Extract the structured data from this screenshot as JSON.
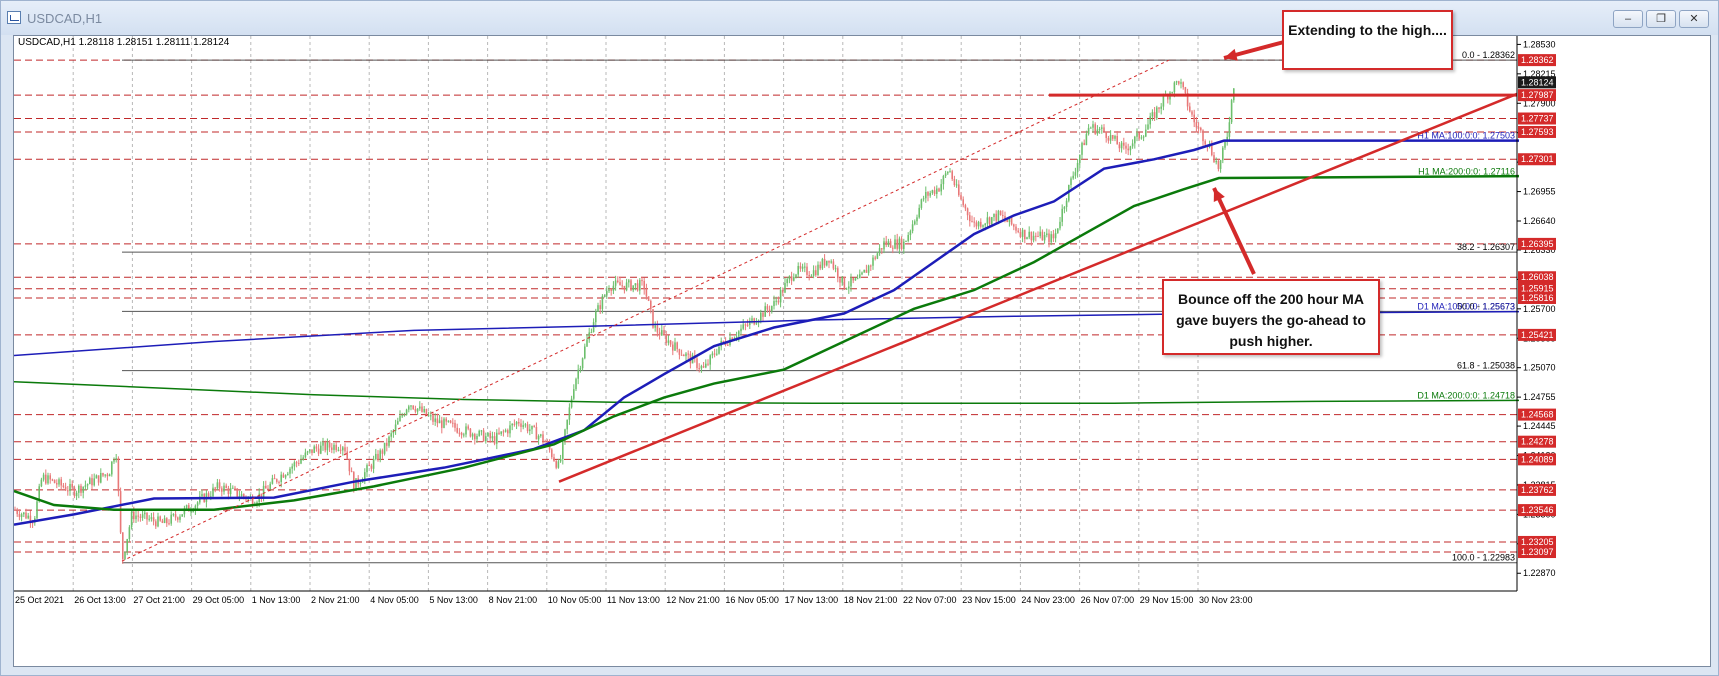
{
  "window": {
    "title": "USDCAD,H1",
    "minimize_icon": "minimize-icon",
    "restore_icon": "restore-icon",
    "close_icon": "close-icon"
  },
  "chart_data": {
    "type": "candlestick",
    "symbol_header": "USDCAD,H1",
    "ohlc_header": "1.28118 1.28151 1.28111 1.28124",
    "timeframe": "H1",
    "ylim": [
      1.2268,
      1.2862
    ],
    "y_ticks": [
      "1.28530",
      "1.28215",
      "1.27900",
      "1.27585",
      "1.27270",
      "1.26955",
      "1.26640",
      "1.26330",
      "1.26015",
      "1.25700",
      "1.25385",
      "1.25070",
      "1.24755",
      "1.24445",
      "1.24130",
      "1.23815",
      "1.23500",
      "1.23185",
      "1.22870"
    ],
    "x_ticks": [
      "25 Oct 2021",
      "26 Oct 13:00",
      "27 Oct 21:00",
      "29 Oct 05:00",
      "1 Nov 13:00",
      "2 Nov 21:00",
      "4 Nov 05:00",
      "5 Nov 13:00",
      "8 Nov 21:00",
      "10 Nov 05:00",
      "11 Nov 13:00",
      "12 Nov 21:00",
      "16 Nov 05:00",
      "17 Nov 13:00",
      "18 Nov 21:00",
      "22 Nov 07:00",
      "23 Nov 15:00",
      "24 Nov 23:00",
      "26 Nov 07:00",
      "29 Nov 15:00",
      "30 Nov 23:00"
    ],
    "current_price": "1.28124",
    "horizontal_levels": [
      {
        "value": 1.28362,
        "label": "1.28362"
      },
      {
        "value": 1.27987,
        "label": "1.27987"
      },
      {
        "value": 1.27737,
        "label": "1.27737"
      },
      {
        "value": 1.27593,
        "label": "1.27593"
      },
      {
        "value": 1.27301,
        "label": "1.27301"
      },
      {
        "value": 1.26395,
        "label": "1.26395"
      },
      {
        "value": 1.26038,
        "label": "1.26038"
      },
      {
        "value": 1.25915,
        "label": "1.25915"
      },
      {
        "value": 1.25816,
        "label": "1.25816"
      },
      {
        "value": 1.25421,
        "label": "1.25421"
      },
      {
        "value": 1.24568,
        "label": "1.24568"
      },
      {
        "value": 1.24278,
        "label": "1.24278"
      },
      {
        "value": 1.24089,
        "label": "1.24089"
      },
      {
        "value": 1.23762,
        "label": "1.23762"
      },
      {
        "value": 1.23546,
        "label": "1.23546"
      },
      {
        "value": 1.23205,
        "label": "1.23205"
      },
      {
        "value": 1.23097,
        "label": "1.23097"
      }
    ],
    "fib_levels": [
      {
        "value": 1.28362,
        "label": "0.0 - 1.28362"
      },
      {
        "value": 1.26307,
        "label": "38.2 - 1.26307"
      },
      {
        "value": 1.25673,
        "label": "50.0 - 1.25673"
      },
      {
        "value": 1.25038,
        "label": "61.8 - 1.25038"
      },
      {
        "value": 1.22983,
        "label": "100.0 - 1.22983"
      }
    ],
    "moving_averages": [
      {
        "name": "H1 MA:100:0:0: 1.27503",
        "value": 1.27503,
        "color": "#1d1db8"
      },
      {
        "name": "H1 MA:200:0:0: 1.27116",
        "value": 1.27116,
        "color": "#0b7a0b"
      },
      {
        "name": "D1 MA:100:0:0: 1.25673",
        "value": 1.25673,
        "color": "#1d1db8"
      },
      {
        "name": "D1 MA:200:0:0: 1.24718",
        "value": 1.24718,
        "color": "#0b7a0b"
      }
    ],
    "colors": {
      "bull": "#6cbf6c",
      "bear": "#e87878",
      "ma100": "#1d1db8",
      "ma200": "#0b7a0b",
      "trend": "#d42a2a",
      "level": "#c0282a",
      "price_label": "#d42a2a",
      "current_label": "#1a1a1a"
    },
    "annotations": [
      {
        "id": "callout-high",
        "text": "Extending to the high...."
      },
      {
        "id": "callout-bounce",
        "text": "Bounce off the 200 hour MA gave buyers the go-ahead to push higher."
      }
    ]
  }
}
